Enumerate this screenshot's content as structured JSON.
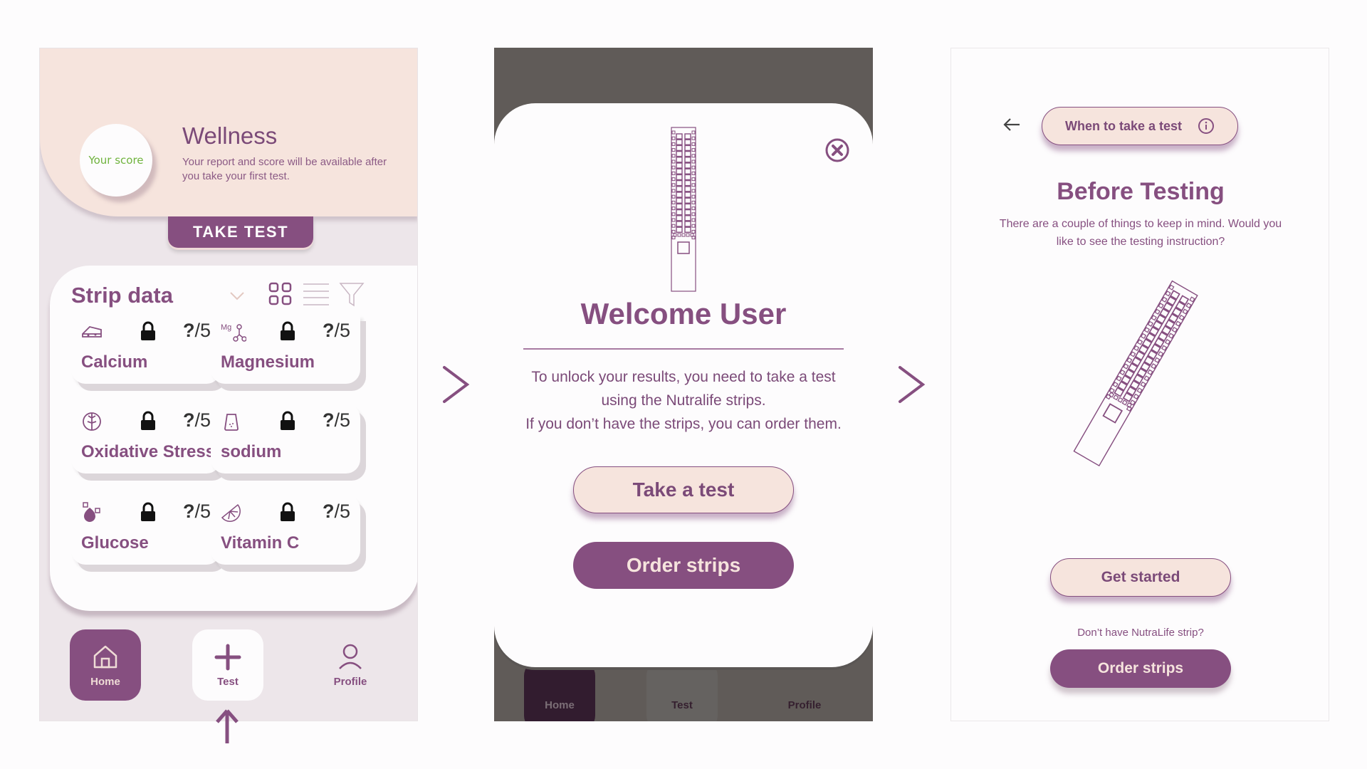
{
  "colors": {
    "primary": "#864f80",
    "peach": "#f6e4dd",
    "score_green": "#6fb33d",
    "overlay": "#605b58"
  },
  "home_screen": {
    "score_label": "Your score",
    "title": "Wellness",
    "subtitle": "Your report and score will be available after you take your first test.",
    "take_test_button": "TAKE TEST",
    "strip_section": {
      "title": "Strip data",
      "dropdown_icon": "chevron-down-icon",
      "tools": [
        "grid-view-icon",
        "list-view-icon",
        "filter-icon"
      ],
      "tiles": [
        {
          "name": "Calcium",
          "icon": "cheese-icon",
          "score": "?",
          "max": "/5",
          "locked": true
        },
        {
          "name": "Magnesium",
          "icon": "magnesium-molecule-icon",
          "score": "?",
          "max": "/5",
          "locked": true
        },
        {
          "name": "Oxidative Stress",
          "icon": "brain-icon",
          "score": "?",
          "max": "/5",
          "locked": true
        },
        {
          "name": "sodium",
          "icon": "salt-shaker-icon",
          "score": "?",
          "max": "/5",
          "locked": true
        },
        {
          "name": "Glucose",
          "icon": "sugar-drop-icon",
          "score": "?",
          "max": "/5",
          "locked": true
        },
        {
          "name": "Vitamin C",
          "icon": "citrus-slice-icon",
          "score": "?",
          "max": "/5",
          "locked": true
        }
      ]
    },
    "nav": [
      {
        "label": "Home",
        "icon": "home-icon",
        "active": true
      },
      {
        "label": "Test",
        "icon": "plus-icon",
        "highlighted": true
      },
      {
        "label": "Profile",
        "icon": "user-icon"
      }
    ]
  },
  "welcome_modal": {
    "title": "Welcome User",
    "body_line1": "To unlock your results, you need to take a test",
    "body_line2": "using the Nutralife strips.",
    "body_line3": "If you don’t have the strips, you can order them.",
    "take_test_button": "Take a test",
    "order_button": "Order strips",
    "background_nav": [
      "Home",
      "Test",
      "Profile"
    ]
  },
  "before_testing": {
    "info_button": "When to take a test",
    "title": "Before Testing",
    "subtitle": "There are a couple of things to keep in mind. Would you like to see the testing instruction?",
    "get_started_button": "Get started",
    "no_strip_note": "Don’t have NutraLife strip?",
    "order_button": "Order strips"
  }
}
